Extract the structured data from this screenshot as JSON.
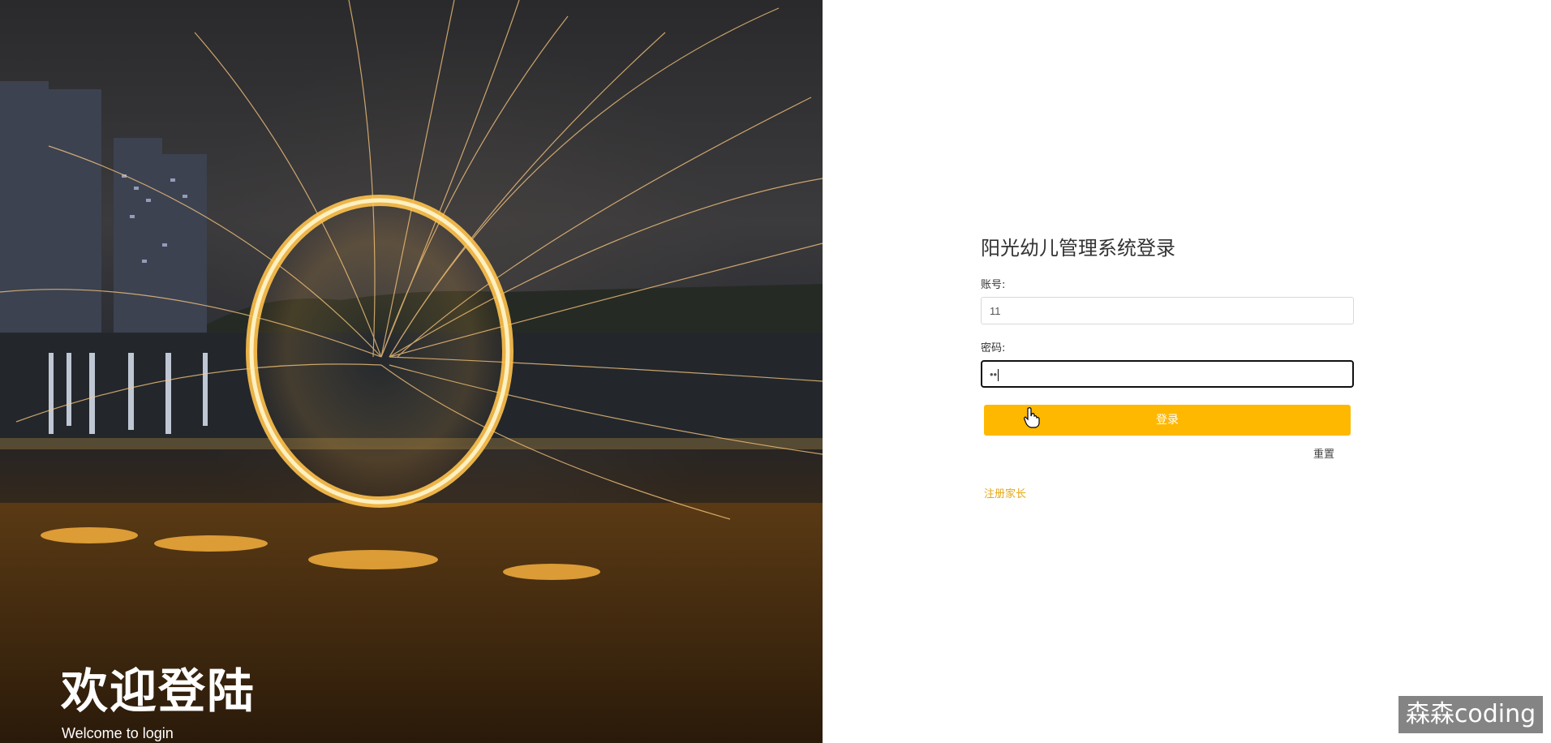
{
  "hero": {
    "title": "欢迎登陆",
    "subtitle": "Welcome to login"
  },
  "form": {
    "title": "阳光幼儿管理系统登录",
    "account_label": "账号:",
    "account_value": "11",
    "password_label": "密码:",
    "password_value": "••",
    "login_label": "登录",
    "reset_label": "重置",
    "register_label": "注册家长"
  },
  "watermark": {
    "text": "森森coding"
  },
  "colors": {
    "accent": "#ffb800",
    "link": "#e6a817",
    "text": "#333333"
  }
}
